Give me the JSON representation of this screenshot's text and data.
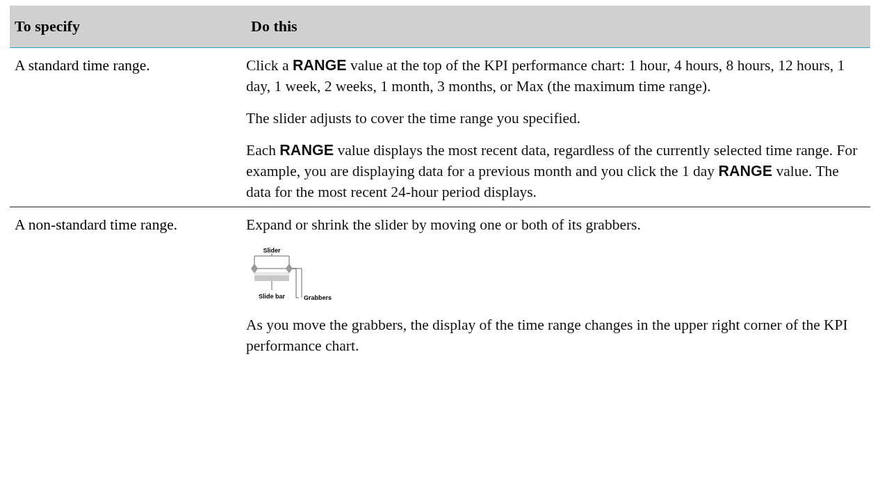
{
  "table": {
    "columns": [
      "To specify",
      "Do this"
    ],
    "rows": [
      {
        "specify": "A standard time range.",
        "content": [
          {
            "kind": "text",
            "text": "Click a **RANGE** value at the top of the KPI performance chart: 1 hour, 4 hours, 8 hours, 12 hours, 1 day, 1 week, 2 weeks, 1 month, 3 months, or Max (the maximum time range)."
          },
          {
            "kind": "text",
            "text": "The slider adjusts to cover the time range you specified."
          },
          {
            "kind": "text",
            "text": "Each **RANGE** value displays the most recent data, regardless of the currently selected time range. For example, you are displaying data for a previous month and you click the 1 day **RANGE** value. The data for the most recent 24-hour period displays."
          }
        ]
      },
      {
        "specify": "A non-standard time range.",
        "content": [
          {
            "kind": "text",
            "text": "Expand or shrink the slider by moving one or both of its grabbers."
          },
          {
            "kind": "diagram",
            "labels": [
              "Slider",
              "Slide bar",
              "Grabbers"
            ]
          },
          {
            "kind": "text",
            "text": "As you move the grabbers, the display of the time range changes in the upper right corner of the KPI performance chart."
          }
        ]
      }
    ]
  }
}
